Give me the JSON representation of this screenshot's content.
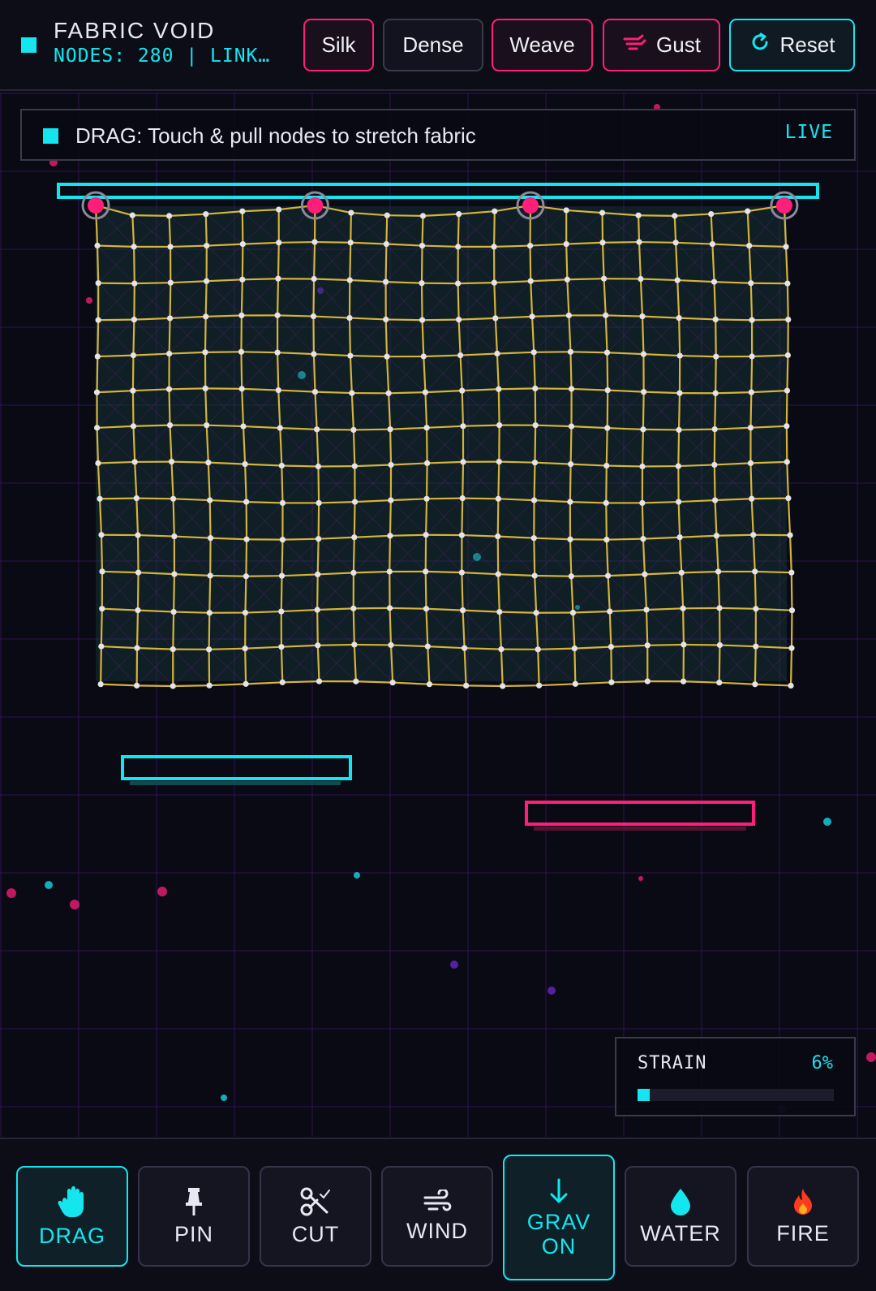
{
  "header": {
    "title": "FABRIC VOID",
    "stats": "NODES: 280 | LINK…",
    "presets": [
      {
        "label": "Silk"
      },
      {
        "label": "Dense"
      },
      {
        "label": "Weave"
      }
    ],
    "gust_label": "Gust",
    "reset_label": "Reset"
  },
  "hint": {
    "text": "DRAG: Touch & pull nodes to stretch fabric",
    "status": "LIVE"
  },
  "strain": {
    "label": "STRAIN",
    "value_text": "6%",
    "fraction": 0.06
  },
  "simulation": {
    "grid_columns": 20,
    "grid_rows": 14,
    "pinned_nodes": 4,
    "cloth_color": "#d4b43a",
    "node_color": "#e4e4e4",
    "pin_color": "#ff1f7a",
    "rail_color": "#14e6f0"
  },
  "tools": [
    {
      "id": "drag",
      "label": "DRAG",
      "icon": "hand-icon",
      "active": true
    },
    {
      "id": "pin",
      "label": "PIN",
      "icon": "pushpin-icon",
      "active": false
    },
    {
      "id": "cut",
      "label": "CUT",
      "icon": "scissors-icon",
      "active": false
    },
    {
      "id": "wind",
      "label": "WIND",
      "icon": "wind-icon",
      "active": false
    },
    {
      "id": "grav",
      "label_line1": "GRAV",
      "label_line2": "ON",
      "icon": "arrow-down-icon",
      "active": true
    },
    {
      "id": "water",
      "label": "WATER",
      "icon": "droplet-icon",
      "active": false
    },
    {
      "id": "fire",
      "label": "FIRE",
      "icon": "flame-icon",
      "active": false
    }
  ],
  "colors": {
    "accent_cyan": "#14e6f0",
    "accent_pink": "#ff1f7a",
    "background": "#0a0a14"
  }
}
